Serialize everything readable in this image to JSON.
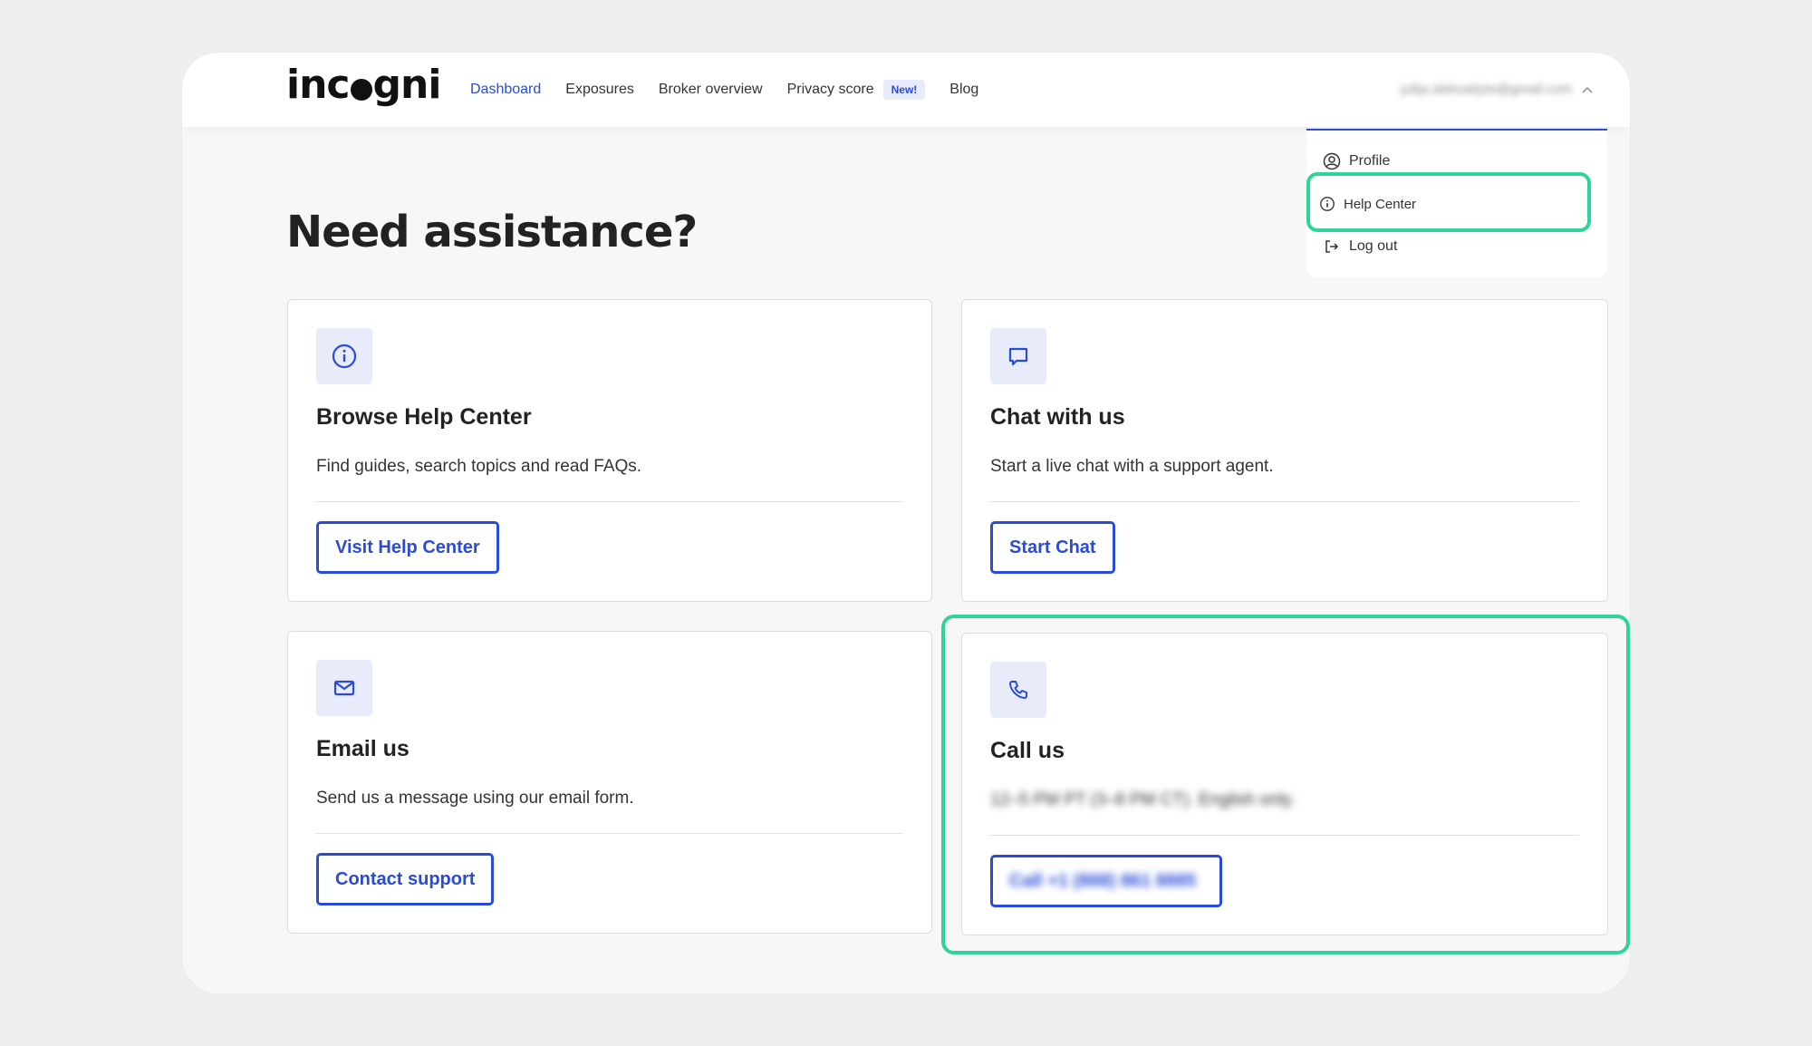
{
  "header": {
    "logo": "incogni",
    "nav": [
      {
        "label": "Dashboard"
      },
      {
        "label": "Exposures"
      },
      {
        "label": "Broker overview"
      },
      {
        "label": "Privacy score"
      },
      {
        "label": "Blog"
      }
    ],
    "badge": "New!",
    "user_email": "julija.aleksaityte@gmail.com"
  },
  "dropdown": {
    "items": [
      {
        "label": "Profile"
      },
      {
        "label": "Help Center"
      },
      {
        "label": "Log out"
      }
    ]
  },
  "page": {
    "title": "Need assistance?"
  },
  "cards": [
    {
      "title": "Browse Help Center",
      "description": "Find guides, search topics and read FAQs.",
      "button": "Visit Help Center",
      "icon": "info-icon"
    },
    {
      "title": "Chat with us",
      "description": "Start a live chat with a support agent.",
      "button": "Start Chat",
      "icon": "chat-icon"
    },
    {
      "title": "Email us",
      "description": "Send us a message using our email form.",
      "button": "Contact support",
      "icon": "mail-icon"
    },
    {
      "title": "Call us",
      "description": "12–5 PM PT (3–8 PM CT). English only.",
      "button": "Call +1 (888) 861 8885",
      "icon": "phone-icon"
    }
  ],
  "colors": {
    "accent": "#2a4bd9",
    "highlight": "#2fd49a",
    "icon_bg": "#e8ecfa"
  }
}
